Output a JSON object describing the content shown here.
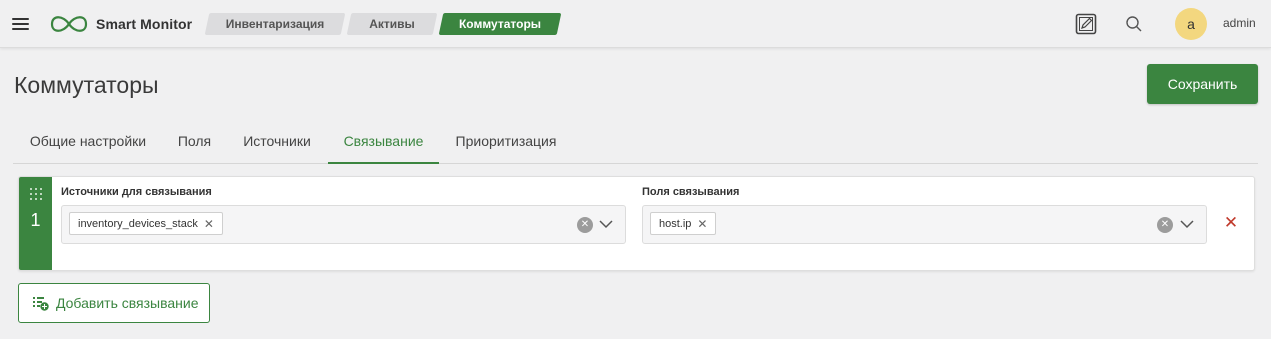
{
  "header": {
    "app_name": "Smart Monitor",
    "breadcrumbs": [
      {
        "label": "Инвентаризация"
      },
      {
        "label": "Активы"
      },
      {
        "label": "Коммутаторы",
        "active": true
      }
    ],
    "icons": [
      "menu-icon",
      "logo-icon",
      "notes-icon",
      "search-icon"
    ],
    "user": {
      "initial": "a",
      "name": "admin"
    }
  },
  "page": {
    "title": "Коммутаторы",
    "save_label": "Сохранить"
  },
  "tabs": [
    {
      "label": "Общие настройки"
    },
    {
      "label": "Поля"
    },
    {
      "label": "Источники"
    },
    {
      "label": "Связывание",
      "active": true
    },
    {
      "label": "Приоритизация"
    }
  ],
  "linking": {
    "rows": [
      {
        "number": "1",
        "sources_label": "Источники для связывания",
        "sources": [
          "inventory_devices_stack"
        ],
        "fields_label": "Поля связывания",
        "fields": [
          "host.ip"
        ]
      }
    ],
    "add_label": "Добавить связывание"
  },
  "colors": {
    "accent": "#3b8540",
    "avatar": "#f3d77f",
    "danger": "#c0392b",
    "background": "#f0f0f1"
  }
}
